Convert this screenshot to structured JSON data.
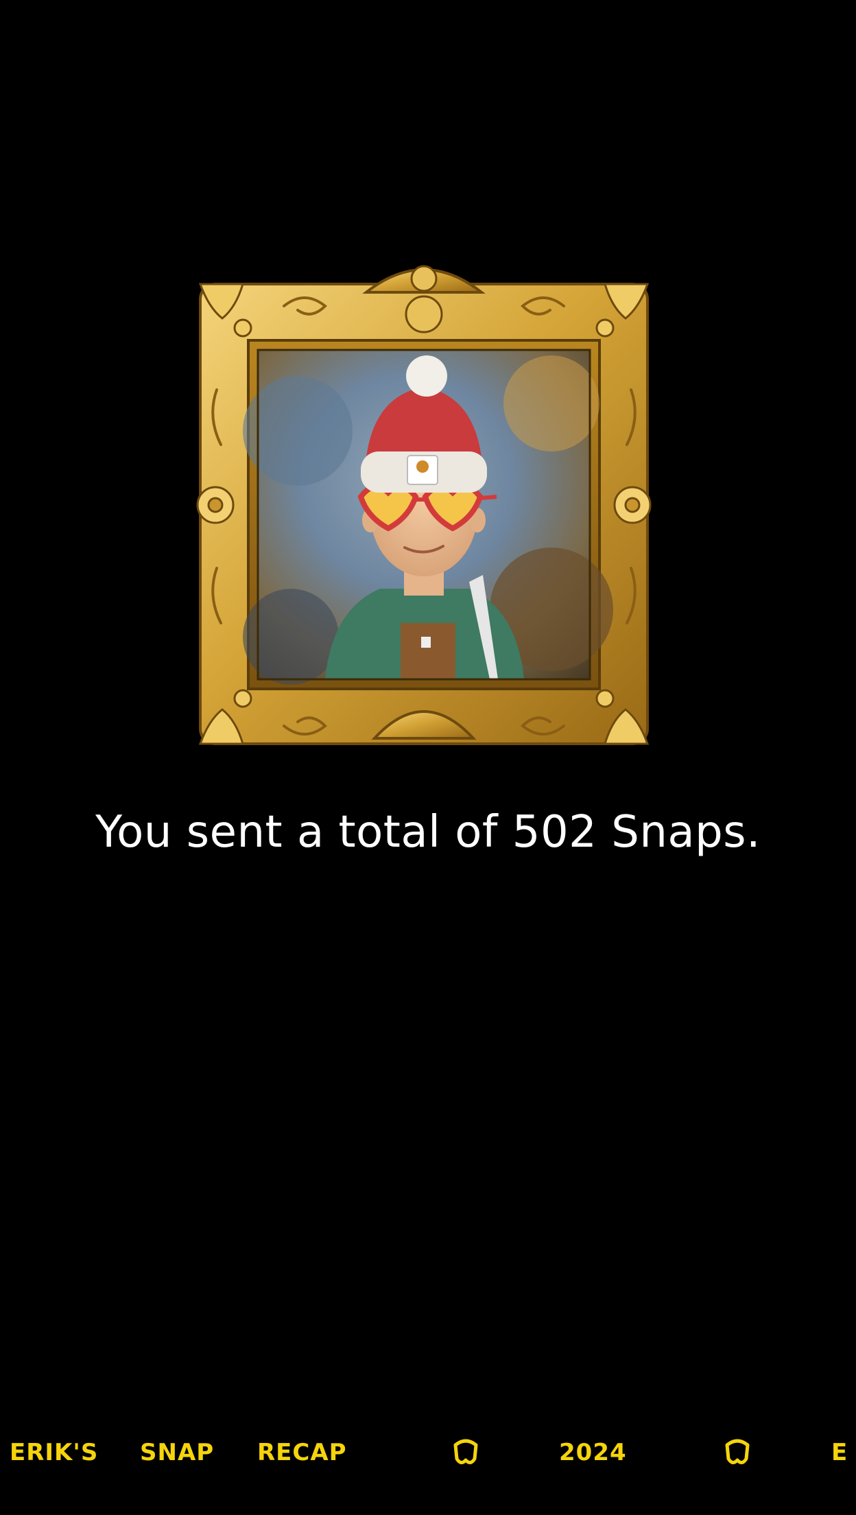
{
  "story": {
    "message": "You sent a total of 502 Snaps.",
    "image": {
      "subject": "bitmoji-avatar-portrait",
      "frame": "ornate-gold-frame"
    }
  },
  "ticker": {
    "items": [
      {
        "text": "ERIK'S"
      },
      {
        "text": "SNAP"
      },
      {
        "text": "RECAP"
      },
      {
        "icon": "snapchat-ghost-icon"
      },
      {
        "text": "2024"
      },
      {
        "icon": "snapchat-ghost-icon"
      },
      {
        "text": "E"
      }
    ]
  },
  "colors": {
    "background": "#000000",
    "text": "#ffffff",
    "ticker": "#f5d40c",
    "frame_gold": "#d4a437"
  }
}
